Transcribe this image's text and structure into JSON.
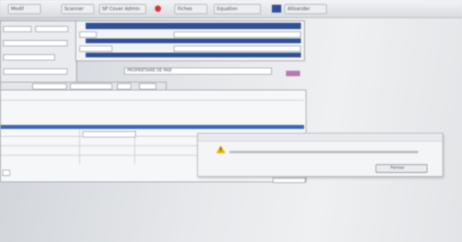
{
  "toolbar": {
    "items": [
      "Modif",
      "Scanner",
      "SP Cover Admin",
      "Fiches",
      "Equation",
      "Alloander"
    ]
  },
  "form": {
    "blue_bars": [
      "",
      "",
      "",
      ""
    ],
    "hint_text": "PROPRIETAIRE DE PAIE"
  },
  "dialog": {
    "title": "",
    "message": "",
    "ok_label": "Fermer"
  },
  "colors": {
    "accent_blue": "#2f4f96",
    "warning": "#e8b400"
  },
  "icons": [
    "warning-icon",
    "record-icon"
  ]
}
